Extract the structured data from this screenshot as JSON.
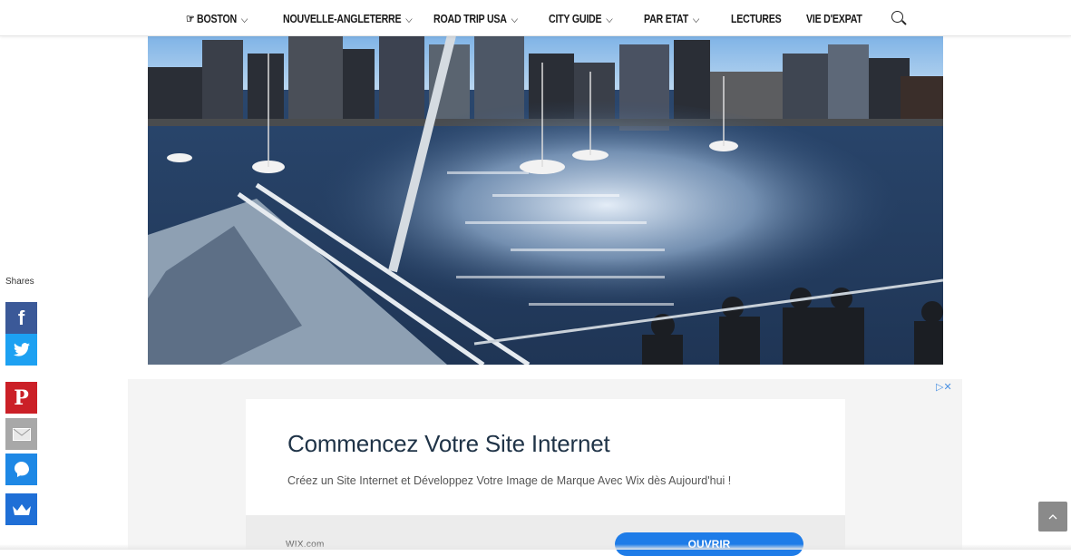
{
  "nav": {
    "items": [
      {
        "label": "☞ BOSTON",
        "dropdown": true
      },
      {
        "label": "NOUVELLE-ANGLETERRE",
        "dropdown": true
      },
      {
        "label": "ROAD TRIP USA",
        "dropdown": true
      },
      {
        "label": "CITY GUIDE",
        "dropdown": true
      },
      {
        "label": "PAR ETAT",
        "dropdown": true
      },
      {
        "label": "LECTURES",
        "dropdown": false
      },
      {
        "label": "VIE D'EXPAT",
        "dropdown": false
      }
    ],
    "search_icon": "search-icon"
  },
  "share_bar": {
    "label": "Shares",
    "buttons": [
      {
        "name": "facebook",
        "color": "#3b5998",
        "icon": "facebook-icon"
      },
      {
        "name": "twitter",
        "color": "#1da1f2",
        "icon": "twitter-icon"
      },
      {
        "name": "pinterest",
        "color": "#cb2027",
        "icon": "pinterest-icon"
      },
      {
        "name": "email",
        "color": "#9e9e9e",
        "icon": "email-icon"
      },
      {
        "name": "messenger",
        "color": "#1e88e5",
        "icon": "messenger-icon"
      },
      {
        "name": "sumome",
        "color": "#1f6fd6",
        "icon": "crown-icon"
      }
    ]
  },
  "ad": {
    "badge": "▷✕",
    "title": "Commencez Votre Site Internet",
    "description": "Créez un Site Internet et Développez Votre Image de Marque Avec Wix dès Aujourd'hui !",
    "domain": "WIX.com",
    "cta": "OUVRIR",
    "cta_color": "#1e7ce8"
  },
  "scroll_top_icon": "chevron-up-icon"
}
